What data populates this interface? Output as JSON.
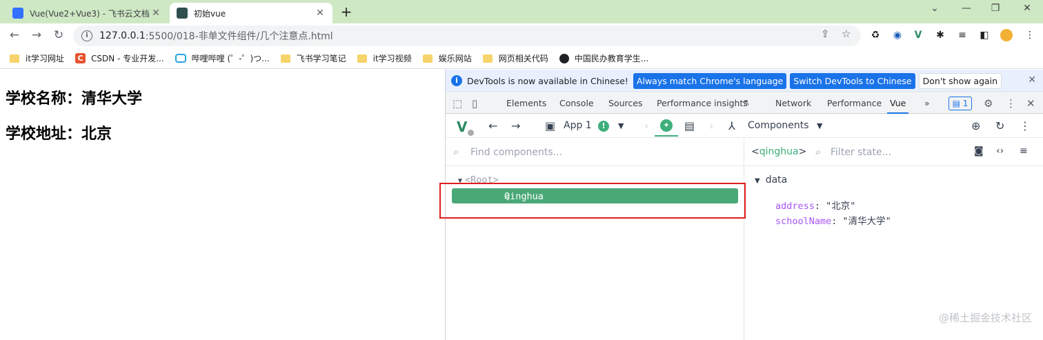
{
  "browser": {
    "tabs": [
      {
        "title": "Vue(Vue2+Vue3) - 飞书云文档",
        "favicon": "doc-icon",
        "color": "#3370ff"
      },
      {
        "title": "初始vue",
        "favicon": "vue-icon",
        "color": "#2f4f4f",
        "active": true
      }
    ],
    "new_tab": "+",
    "window_controls": [
      "⌄",
      "—",
      "❐",
      "✕"
    ],
    "url_host": "127.0.0.1",
    "url_path": ":5500/018-非单文件组件/几个注意点.html",
    "info_glyph": "i"
  },
  "bookmarks": [
    {
      "label": "it学习网址",
      "icon": "folder-icon"
    },
    {
      "label": "CSDN - 专业开发...",
      "icon": "csdn-icon",
      "glyph": "C"
    },
    {
      "label": "哔哩哔哩 (゜-゜)つ...",
      "icon": "bilibili-icon"
    },
    {
      "label": "飞书学习笔记",
      "icon": "folder-icon"
    },
    {
      "label": "it学习视频",
      "icon": "folder-icon"
    },
    {
      "label": "娱乐网站",
      "icon": "folder-icon"
    },
    {
      "label": "网页相关代码",
      "icon": "folder-icon"
    },
    {
      "label": "中国民办教育学生...",
      "icon": "globe-icon"
    }
  ],
  "page": {
    "school_name": "学校名称：清华大学",
    "school_address": "学校地址：北京"
  },
  "devtools": {
    "info_message": "DevTools is now available in Chinese!",
    "btn_match": "Always match Chrome's language",
    "btn_switch": "Switch DevTools to Chinese",
    "btn_dismiss": "Don't show again",
    "tabs": [
      "Elements",
      "Console",
      "Sources",
      "Performance insights",
      "Network",
      "Performance",
      "Vue"
    ],
    "active_tab": "Vue",
    "overflow": "»",
    "issues_count": "1",
    "vue": {
      "logo": "V",
      "app_label": "App 1",
      "app_warn": "!",
      "components_label": "Components",
      "find_placeholder": "Find components...",
      "root_label": "<Root>",
      "selected": {
        "open": "<",
        "name": "Qinghua",
        "close": ">"
      },
      "state_component": {
        "open": "<",
        "name": "qinghua",
        "close": ">"
      },
      "filter_placeholder": "Filter state...",
      "section": "data",
      "props": [
        {
          "key": "address",
          "value": "\"北京\""
        },
        {
          "key": "schoolName",
          "value": "\"清华大学\""
        }
      ]
    }
  },
  "watermark": "@稀土掘金技术社区",
  "colors": {
    "vue_green": "#3eaf7c",
    "selected_row": "#4aa877",
    "highlight_box": "#e11d1d",
    "chrome_blue": "#1a73e8"
  }
}
